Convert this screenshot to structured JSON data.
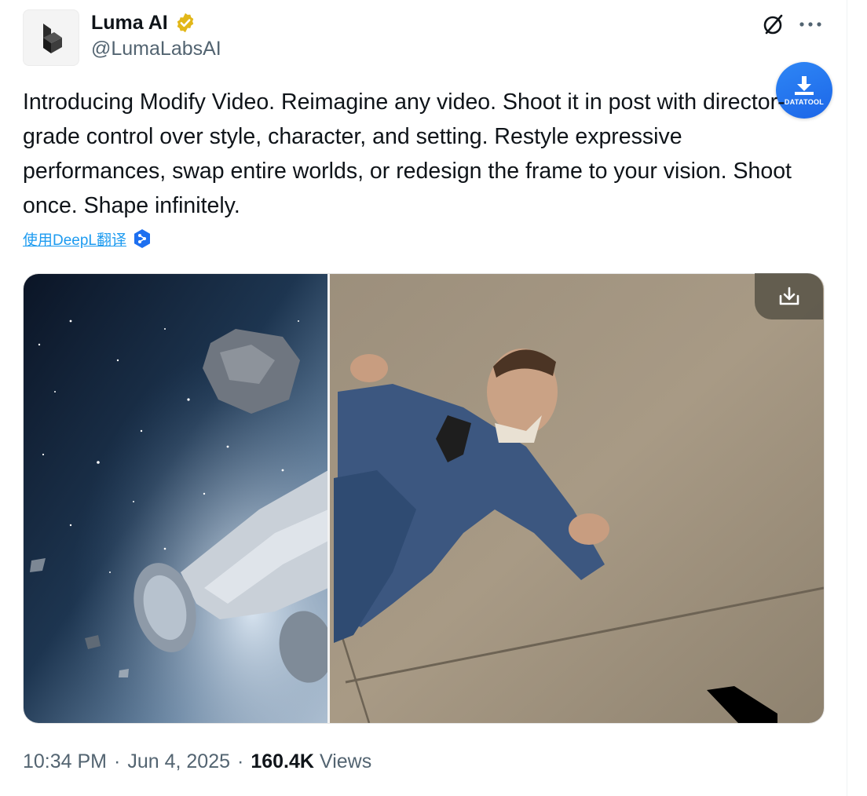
{
  "author": {
    "display_name": "Luma AI",
    "handle": "@LumaLabsAI",
    "verified": true,
    "verified_badge_color": "#e2b719"
  },
  "actions": {
    "grok_icon": "grok-icon",
    "more_icon": "more-icon"
  },
  "extension": {
    "label": "DATATOOL",
    "color": "#1d6ff0"
  },
  "tweet": {
    "text": "Introducing Modify Video. Reimagine any video. Shoot it in post with director-grade control over style, character, and setting. Restyle expressive performances, swap entire worlds, or redesign the frame to your vision. Shoot once. Shape infinitely.",
    "translate_label": "使用DeepL翻译"
  },
  "meta": {
    "time": "10:34 PM",
    "date": "Jun 4, 2025",
    "views_count": "160.4K",
    "views_label": "Views",
    "separator": "·"
  },
  "colors": {
    "text_primary": "#0f1419",
    "text_secondary": "#536471",
    "link": "#1d9bf0"
  }
}
